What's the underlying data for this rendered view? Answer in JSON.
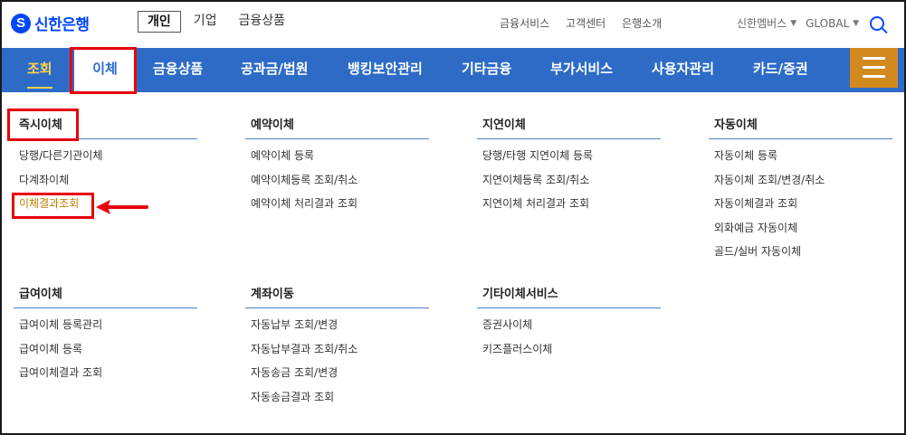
{
  "brand": {
    "name": "신한은행"
  },
  "segments": [
    {
      "label": "개인",
      "active": true
    },
    {
      "label": "기업",
      "active": false
    },
    {
      "label": "금융상품",
      "active": false
    }
  ],
  "util_links": [
    "금융서비스",
    "고객센터",
    "은행소개"
  ],
  "members": {
    "label": "신한멤버스"
  },
  "global": {
    "label": "GLOBAL"
  },
  "nav": {
    "items": [
      "조회",
      "이체",
      "금융상품",
      "공과금/법원",
      "뱅킹보안관리",
      "기타금융",
      "부가서비스",
      "사용자관리",
      "카드/증권"
    ],
    "current": "조회",
    "selected": "이체"
  },
  "menu": {
    "columns": [
      {
        "title": "즉시이체",
        "items": [
          "당행/다른기관이체",
          "다계좌이체",
          "이체결과조회"
        ]
      },
      {
        "title": "예약이체",
        "items": [
          "예약이체 등록",
          "예약이체등록 조회/취소",
          "예약이체 처리결과 조회"
        ]
      },
      {
        "title": "지연이체",
        "items": [
          "당행/타행 지연이체 등록",
          "지연이체등록 조회/취소",
          "지연이체 처리결과 조회"
        ]
      },
      {
        "title": "자동이체",
        "items": [
          "자동이체 등록",
          "자동이체 조회/변경/취소",
          "자동이체결과 조회",
          "외화예금 자동이체",
          "골드/실버 자동이체"
        ]
      },
      {
        "title": "급여이체",
        "items": [
          "급여이체 등록관리",
          "급여이체 등록",
          "급여이체결과 조회"
        ]
      },
      {
        "title": "계좌이동",
        "items": [
          "자동납부 조회/변경",
          "자동납부결과 조회/취소",
          "자동송금 조회/변경",
          "자동송금결과 조회"
        ]
      },
      {
        "title": "기타이체서비스",
        "items": [
          "증권사이체",
          "키즈플러스이체"
        ]
      }
    ],
    "highlighted_item": "이체결과조회"
  },
  "colors": {
    "brand_blue": "#0046ff",
    "nav_blue": "#2d6bc7",
    "hamburger": "#d28a1f",
    "annotation_red": "#e8000b",
    "highlight_text": "#c07b00"
  }
}
